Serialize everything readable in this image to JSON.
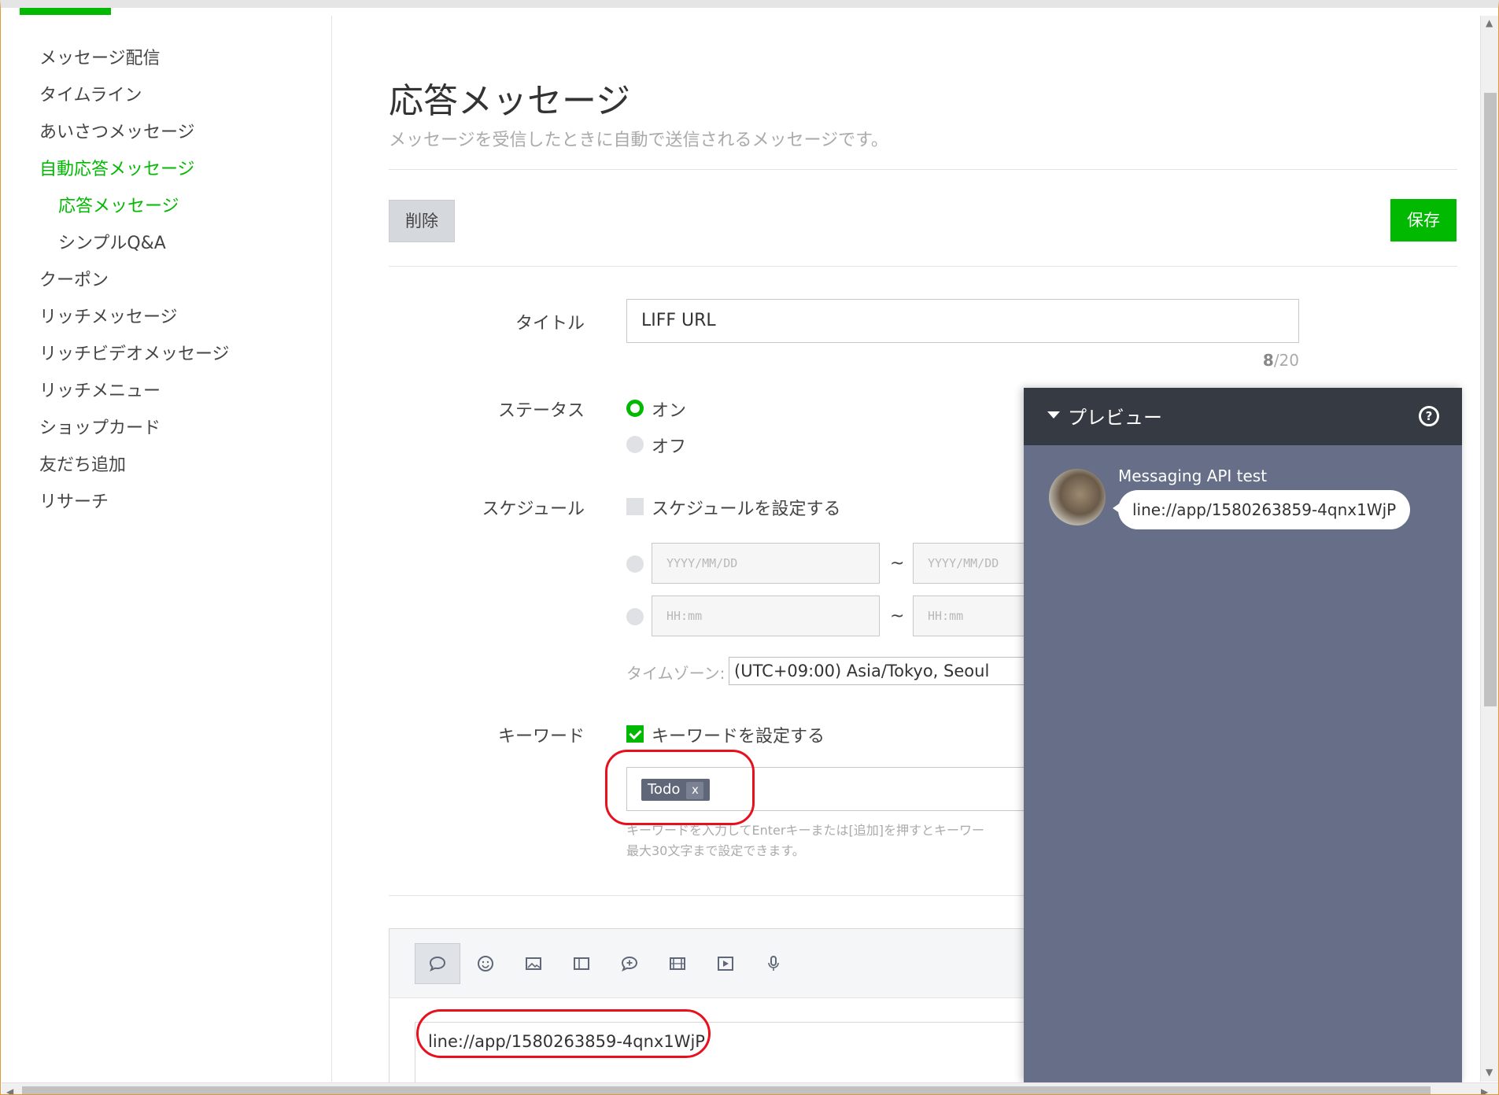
{
  "sidebar": {
    "items": [
      {
        "label": "メッセージ配信"
      },
      {
        "label": "タイムライン"
      },
      {
        "label": "あいさつメッセージ"
      },
      {
        "label": "自動応答メッセージ"
      },
      {
        "label": "応答メッセージ"
      },
      {
        "label": "シンプルQ&A"
      },
      {
        "label": "クーポン"
      },
      {
        "label": "リッチメッセージ"
      },
      {
        "label": "リッチビデオメッセージ"
      },
      {
        "label": "リッチメニュー"
      },
      {
        "label": "ショップカード"
      },
      {
        "label": "友だち追加"
      },
      {
        "label": "リサーチ"
      }
    ]
  },
  "header": {
    "title": "応答メッセージ",
    "description": "メッセージを受信したときに自動で送信されるメッセージです。"
  },
  "actions": {
    "delete_label": "削除",
    "save_label": "保存"
  },
  "form": {
    "title_label": "タイトル",
    "title_value": "LIFF URL",
    "title_count": "8",
    "title_max": "/20",
    "status_label": "ステータス",
    "status_on": "オン",
    "status_off": "オフ",
    "schedule_label": "スケジュール",
    "schedule_checkbox": "スケジュールを設定する",
    "date_placeholder": "YYYY/MM/DD",
    "time_placeholder": "HH:mm",
    "tilde": "~",
    "timezone_label": "タイムゾーン:",
    "timezone_value": "(UTC+09:00) Asia/Tokyo, Seoul",
    "keyword_label": "キーワード",
    "keyword_checkbox": "キーワードを設定する",
    "keyword_tag": "Todo",
    "keyword_tag_remove": "x",
    "keyword_help_1": "キーワードを入力してEnterキーまたは[追加]を押すとキーワー",
    "keyword_help_2": "最大30文字まで設定できます。"
  },
  "editor": {
    "text": "line://app/1580263859-4qnx1WjP",
    "tools": [
      "text-icon",
      "emoji-icon",
      "image-icon",
      "coupon-icon",
      "richmessage-icon",
      "video-icon",
      "play-icon",
      "mic-icon"
    ]
  },
  "preview": {
    "title": "プレビュー",
    "help": "?",
    "sender": "Messaging API test",
    "message": "line://app/1580263859-4qnx1WjP"
  },
  "colors": {
    "accent": "#00b900",
    "preview_bg": "#666f87",
    "preview_header": "#363a42",
    "annotation": "#e8101c"
  }
}
